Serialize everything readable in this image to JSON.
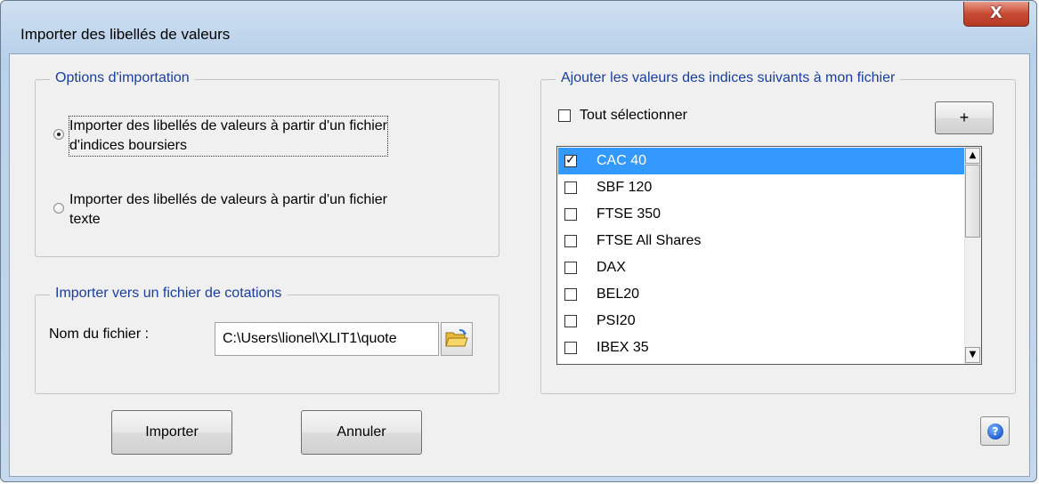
{
  "window": {
    "title": "Importer des libellés de valeurs",
    "close_glyph": "X"
  },
  "options_group": {
    "legend": "Options d'importation",
    "radio1": {
      "label_line1": "Importer des libellés de valeurs à partir d'un fichier",
      "label_line2": "d'indices boursiers",
      "checked": true
    },
    "radio2": {
      "label_line1": "Importer des libellés de valeurs à partir d'un fichier",
      "label_line2": "texte",
      "checked": false
    }
  },
  "export_group": {
    "legend": "Importer vers un fichier de cotations",
    "file_label": "Nom du fichier :",
    "file_value": "C:\\Users\\lionel\\XLIT1\\quote",
    "browse_icon": "folder-open-icon"
  },
  "indices_group": {
    "legend": "Ajouter les valeurs des indices suivants à mon fichier",
    "select_all_label": "Tout sélectionner",
    "select_all_checked": false,
    "add_button_label": "+",
    "items": [
      {
        "label": "CAC 40",
        "checked": true,
        "selected": true
      },
      {
        "label": "SBF 120",
        "checked": false,
        "selected": false
      },
      {
        "label": "FTSE 350",
        "checked": false,
        "selected": false
      },
      {
        "label": "FTSE All Shares",
        "checked": false,
        "selected": false
      },
      {
        "label": "DAX",
        "checked": false,
        "selected": false
      },
      {
        "label": "BEL20",
        "checked": false,
        "selected": false
      },
      {
        "label": "PSI20",
        "checked": false,
        "selected": false
      },
      {
        "label": "IBEX 35",
        "checked": false,
        "selected": false
      }
    ],
    "scroll_up_glyph": "▲",
    "scroll_down_glyph": "▼"
  },
  "buttons": {
    "import_label": "Importer",
    "cancel_label": "Annuler",
    "help_glyph": "?"
  },
  "colors": {
    "legend_text": "#1a3e9c",
    "selection": "#3399ff",
    "close_button": "#c84a34"
  }
}
